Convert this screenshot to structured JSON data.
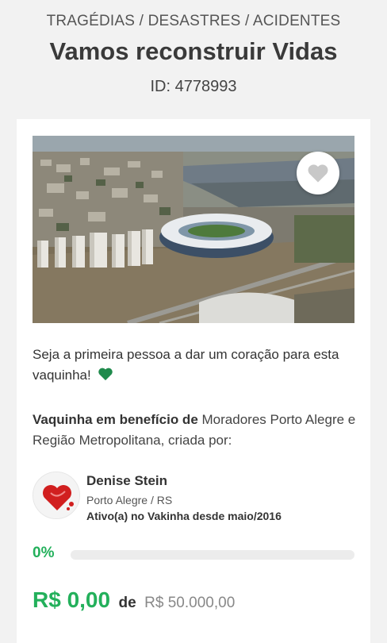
{
  "header": {
    "category": "TRAGÉDIAS / DESASTRES / ACIDENTES",
    "title": "Vamos reconstruir Vidas",
    "campaign_id": "ID: 4778993"
  },
  "card": {
    "favorite_icon": "heart-icon",
    "heart_message": "Seja a primeira pessoa a dar um coração para esta vaquinha!",
    "heart_message_icon": "green-heart-icon",
    "beneficiary_label": "Vaquinha em benefício de",
    "beneficiary_text": "Moradores Porto Alegre e Região Metropolitana, criada por:",
    "creator": {
      "name": "Denise Stein",
      "location": "Porto Alegre / RS",
      "active_since": "Ativo(a) no Vakinha desde maio/2016"
    },
    "progress": {
      "percent_label": "0%",
      "fraction": 0
    },
    "amount": {
      "raised": "R$ 0,00",
      "connector": "de",
      "goal": "R$ 50.000,00"
    }
  },
  "colors": {
    "accent_green": "#23b05b",
    "background": "#f2f2f2",
    "card": "#ffffff"
  }
}
